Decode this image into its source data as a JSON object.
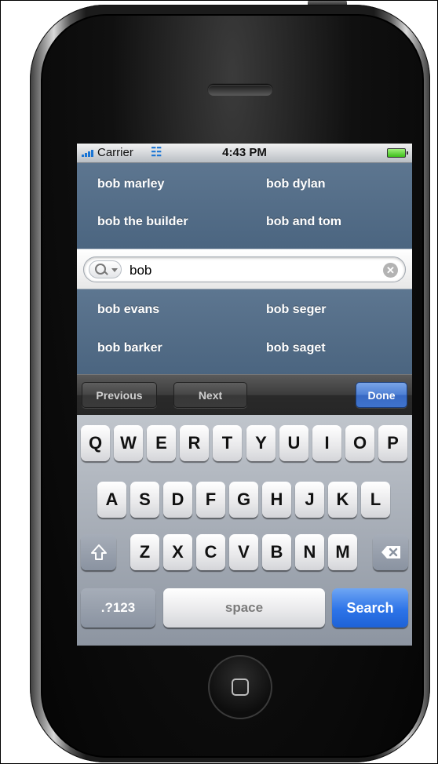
{
  "status_bar": {
    "carrier": "Carrier",
    "time": "4:43 PM"
  },
  "suggestions": {
    "top": [
      "bob marley",
      "bob dylan",
      "bob the builder",
      "bob and tom"
    ],
    "bottom": [
      "bob evans",
      "bob seger",
      "bob barker",
      "bob saget"
    ]
  },
  "search": {
    "value": "bob"
  },
  "toolbar": {
    "previous": "Previous",
    "next": "Next",
    "done": "Done"
  },
  "keyboard": {
    "row1": [
      "Q",
      "W",
      "E",
      "R",
      "T",
      "Y",
      "U",
      "I",
      "O",
      "P"
    ],
    "row2": [
      "A",
      "S",
      "D",
      "F",
      "G",
      "H",
      "J",
      "K",
      "L"
    ],
    "row3": [
      "Z",
      "X",
      "C",
      "V",
      "B",
      "N",
      "M"
    ],
    "numbers_key": ".?123",
    "space_key": "space",
    "search_key": "Search"
  },
  "colors": {
    "suggestion_bg": "#4f6984",
    "done_blue": "#4d7fd4",
    "search_key_blue": "#2d74e8"
  }
}
